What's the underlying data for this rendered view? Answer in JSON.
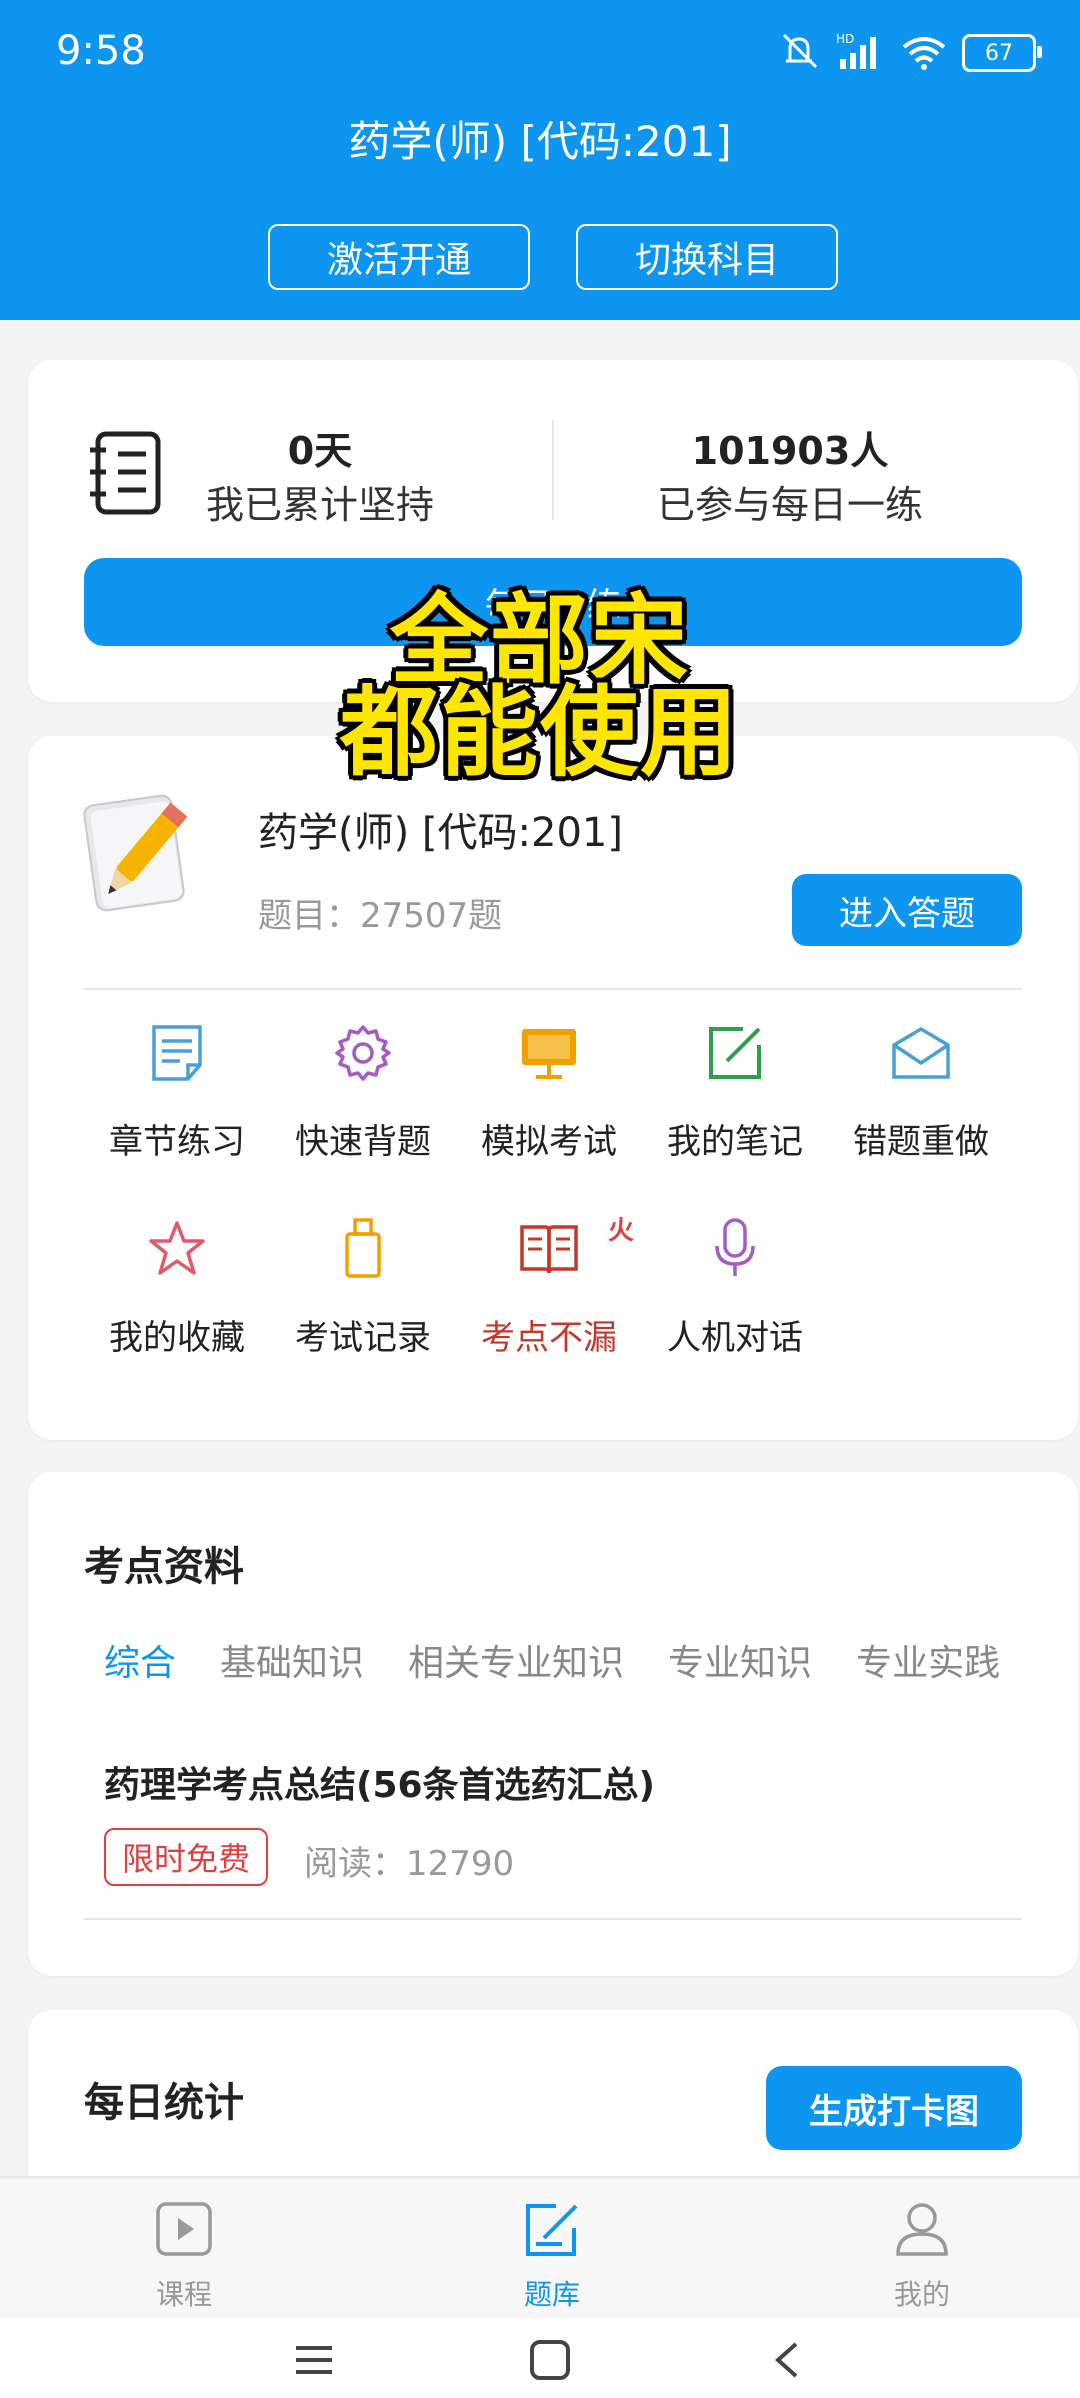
{
  "status_bar": {
    "time": "9:58",
    "battery": "67",
    "network": "HD"
  },
  "header": {
    "title": "药学(师) [代码:201]",
    "activate_label": "激活开通",
    "switch_label": "切换科目"
  },
  "stats": {
    "days_value": "0天",
    "days_label": "我已累计坚持",
    "participants_value": "101903人",
    "participants_label": "已参与每日一练",
    "daily_button": "每日一练"
  },
  "overlay": {
    "line1": "全部宋",
    "line2": "都能使用"
  },
  "subject": {
    "title": "药学(师) [代码:201]",
    "count": "题目：27507题",
    "enter_label": "进入答题"
  },
  "features": [
    {
      "label": "章节练习",
      "icon": "document-icon",
      "color": "#4a9fd8"
    },
    {
      "label": "快速背题",
      "icon": "gear-icon",
      "color": "#a55bc4"
    },
    {
      "label": "模拟考试",
      "icon": "monitor-icon",
      "color": "#f0a000"
    },
    {
      "label": "我的笔记",
      "icon": "edit-icon",
      "color": "#2e9e4f"
    },
    {
      "label": "错题重做",
      "icon": "envelope-icon",
      "color": "#4a9fd8"
    },
    {
      "label": "我的收藏",
      "icon": "star-icon",
      "color": "#e05a6a"
    },
    {
      "label": "考试记录",
      "icon": "usb-icon",
      "color": "#f0a000"
    },
    {
      "label": "考点不漏",
      "icon": "book-icon",
      "color": "#c0392b",
      "hot": "火"
    },
    {
      "label": "人机对话",
      "icon": "microphone-icon",
      "color": "#a55bc4"
    }
  ],
  "materials": {
    "title": "考点资料",
    "tabs": [
      "综合",
      "基础知识",
      "相关专业知识",
      "专业知识",
      "专业实践"
    ],
    "active_tab": "综合",
    "article_title": "药理学考点总结(56条首选药汇总)",
    "badge": "限时免费",
    "reads": "阅读：12790"
  },
  "daily_stats": {
    "title": "每日统计",
    "generate_label": "生成打卡图"
  },
  "bottom_nav": [
    {
      "label": "课程",
      "icon": "play-icon"
    },
    {
      "label": "题库",
      "icon": "edit-box-icon",
      "active": true
    },
    {
      "label": "我的",
      "icon": "person-icon"
    }
  ],
  "colors": {
    "accent": "#0d95f0",
    "hot": "#c0392b",
    "badge": "#e04040",
    "overlay_text": "#ffe600"
  }
}
